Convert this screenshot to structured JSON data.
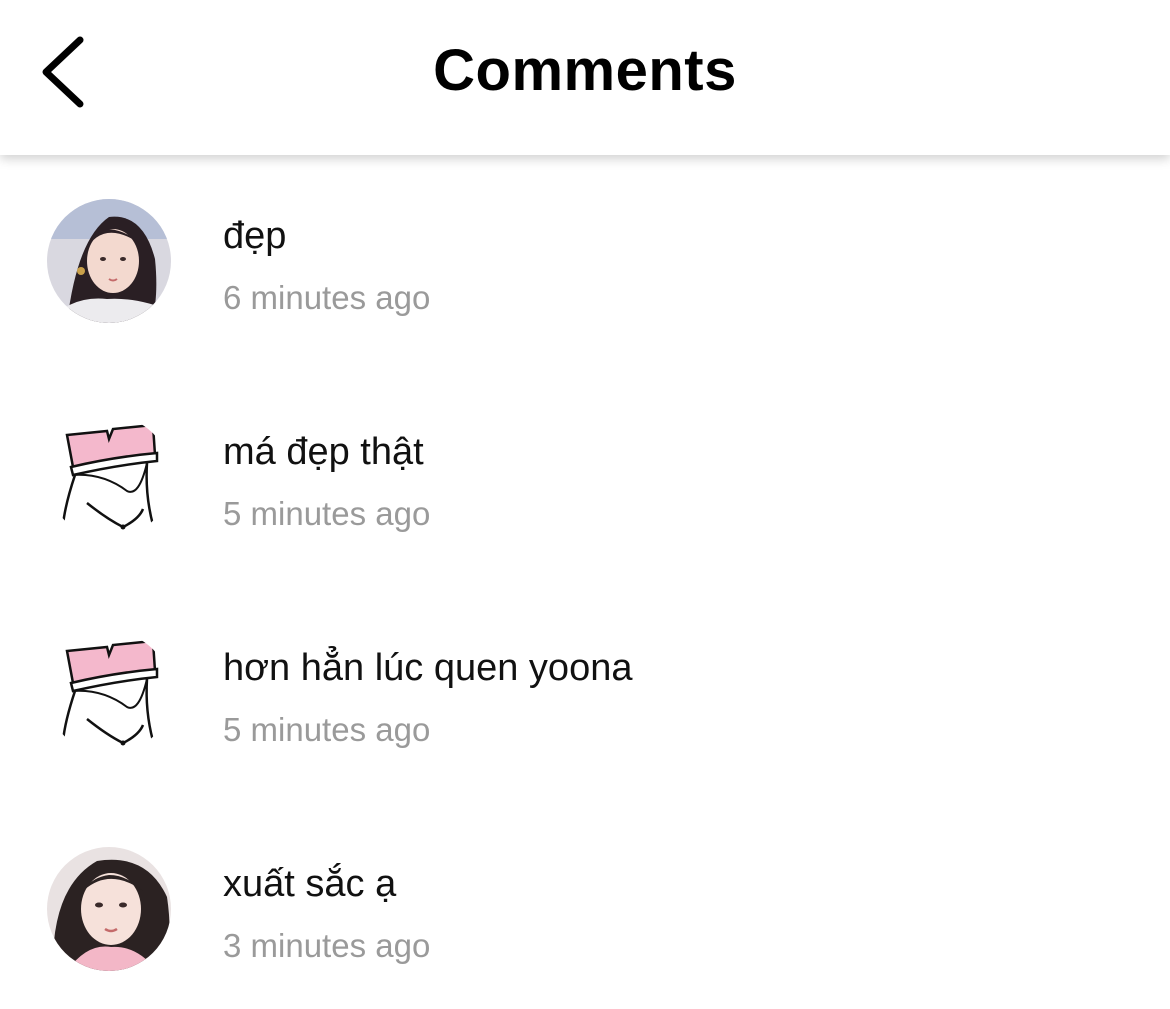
{
  "header": {
    "title": "Comments",
    "back_icon": "chevron-left-icon"
  },
  "comments": [
    {
      "avatar": "photo-avatar",
      "text": "đẹp",
      "time": "6 minutes ago"
    },
    {
      "avatar": "sketch-avatar",
      "text": "má đẹp thật",
      "time": "5 minutes ago"
    },
    {
      "avatar": "sketch-avatar",
      "text": "hơn hẳn lúc quen yoona",
      "time": "5 minutes ago"
    },
    {
      "avatar": "photo-avatar",
      "text": "xuất sắc ạ",
      "time": "3 minutes ago"
    }
  ],
  "colors": {
    "text": "#111111",
    "timestamp": "#9a9a9a",
    "background": "#ffffff",
    "hat_pink": "#f4b8cc"
  }
}
